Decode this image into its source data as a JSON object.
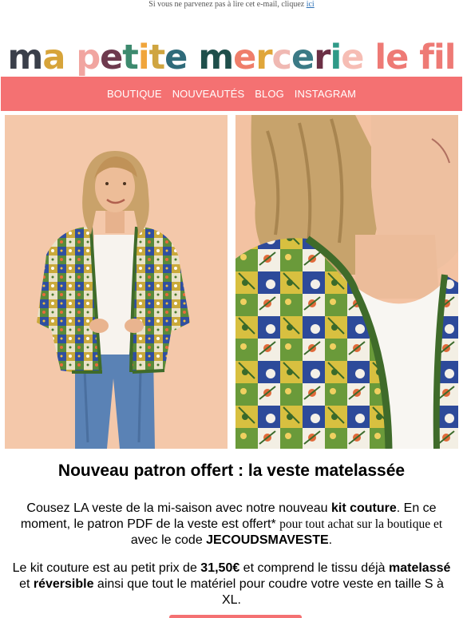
{
  "preheader": {
    "text": "Si vous ne parvenez pas à lire cet e-mail, cliquez ",
    "link": "ici"
  },
  "logo": {
    "words": [
      {
        "word": "ma",
        "letters": [
          {
            "c": "m",
            "color": "#3a3f4a"
          },
          {
            "c": "a",
            "color": "#d7a43a"
          }
        ]
      },
      {
        "word": "petite",
        "letters": [
          {
            "c": "p",
            "color": "#f1a5a0"
          },
          {
            "c": "e",
            "color": "#6e3a4e"
          },
          {
            "c": "t",
            "color": "#3d8a6e"
          },
          {
            "c": "i",
            "color": "#f0a53b"
          },
          {
            "c": "t",
            "color": "#cfa540"
          },
          {
            "c": "e",
            "color": "#2f6b7a"
          }
        ]
      },
      {
        "word": "mercerie",
        "letters": [
          {
            "c": "m",
            "color": "#1f4f4b"
          },
          {
            "c": "e",
            "color": "#ef7e6a"
          },
          {
            "c": "r",
            "color": "#e0a63a"
          },
          {
            "c": "c",
            "color": "#f0b9b3"
          },
          {
            "c": "e",
            "color": "#3b7a86"
          },
          {
            "c": "r",
            "color": "#6b2f45"
          },
          {
            "c": "i",
            "color": "#2f9a88"
          },
          {
            "c": "e",
            "color": "#f6bdb4"
          }
        ]
      },
      {
        "word": "le",
        "letters": [
          {
            "c": "l",
            "color": "#ee7a75"
          },
          {
            "c": "e",
            "color": "#ee7a75"
          }
        ]
      },
      {
        "word": "fil",
        "letters": [
          {
            "c": "f",
            "color": "#ee7a75"
          },
          {
            "c": "i",
            "color": "#ee7a75"
          },
          {
            "c": "l",
            "color": "#ee7a75"
          }
        ]
      }
    ]
  },
  "nav": {
    "items": [
      "BOUTIQUE",
      "NOUVEAUTÉS",
      "BLOG",
      "INSTAGRAM"
    ]
  },
  "images": {
    "left_alt": "Femme portant la veste matelassée patchwork",
    "right_alt": "Détail de la veste matelassée patchwork"
  },
  "headline": "Nouveau patron offert : la veste matelassée",
  "para1": {
    "t1": "Cousez LA veste de la mi-saison avec notre nouveau ",
    "b1": "kit couture",
    "t2": ". En ce moment, le patron PDF de la veste est offert* ",
    "s1": "pour tout achat sur la boutique et",
    "t3": " avec le code ",
    "b2": "JECOUDSMAVESTE",
    "t4": "."
  },
  "para2": {
    "t1": "Le kit couture est au petit prix de ",
    "b1": "31,50€",
    "t2": " et comprend le tissu déjà ",
    "b2": "matelassé",
    "t3": " et ",
    "b3": "réversible",
    "t4": " ainsi que tout le matériel pour coudre votre veste en taille S à XL."
  },
  "colors": {
    "nav_bg": "#f47172",
    "nav_text": "#ffffff",
    "photo_bg": "#f4c5a6",
    "jacket_trim": "#3f6b2a",
    "link": "#2a6fb5"
  }
}
